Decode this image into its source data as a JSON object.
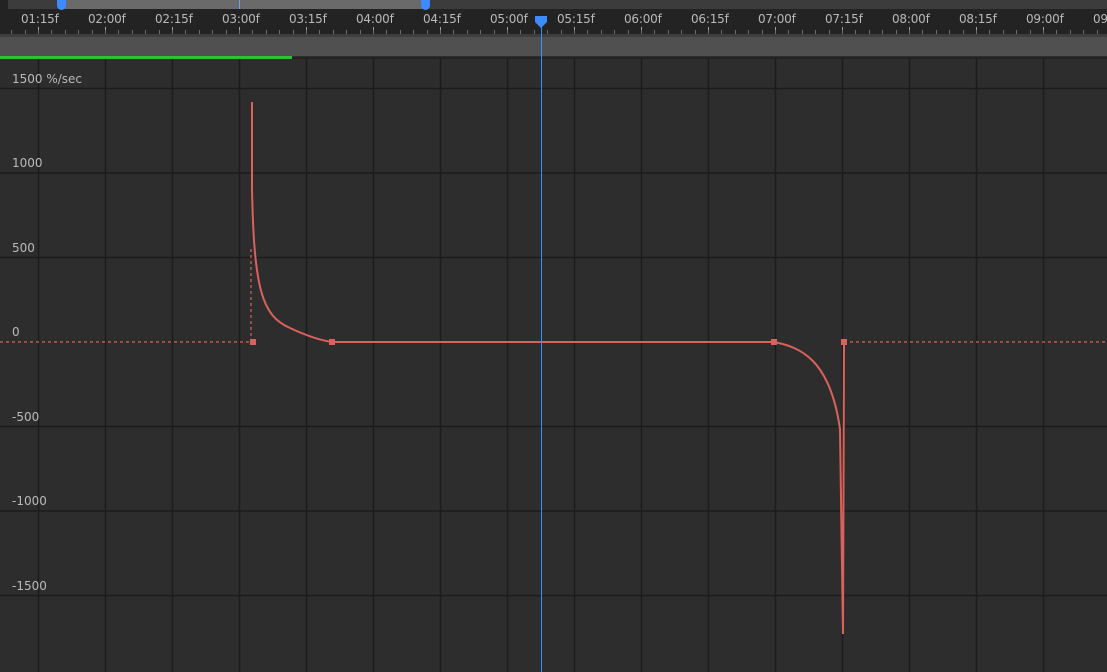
{
  "timeline": {
    "time_labels": [
      "01:15f",
      "02:00f",
      "02:15f",
      "03:00f",
      "03:15f",
      "04:00f",
      "04:15f",
      "05:00f",
      "05:15f",
      "06:00f",
      "06:15f",
      "07:00f",
      "07:15f",
      "08:00f",
      "08:15f",
      "09:00f",
      "09:"
    ],
    "current_time_index": 7.5
  },
  "graph": {
    "unit_label": "1500 %/sec",
    "value_labels": [
      "1000",
      "500",
      "0",
      "-500",
      "-1000",
      "-1500"
    ],
    "curve_color": "#d9625d",
    "playhead_color": "#3d8cff",
    "work_area_color": "#29c23a"
  }
}
